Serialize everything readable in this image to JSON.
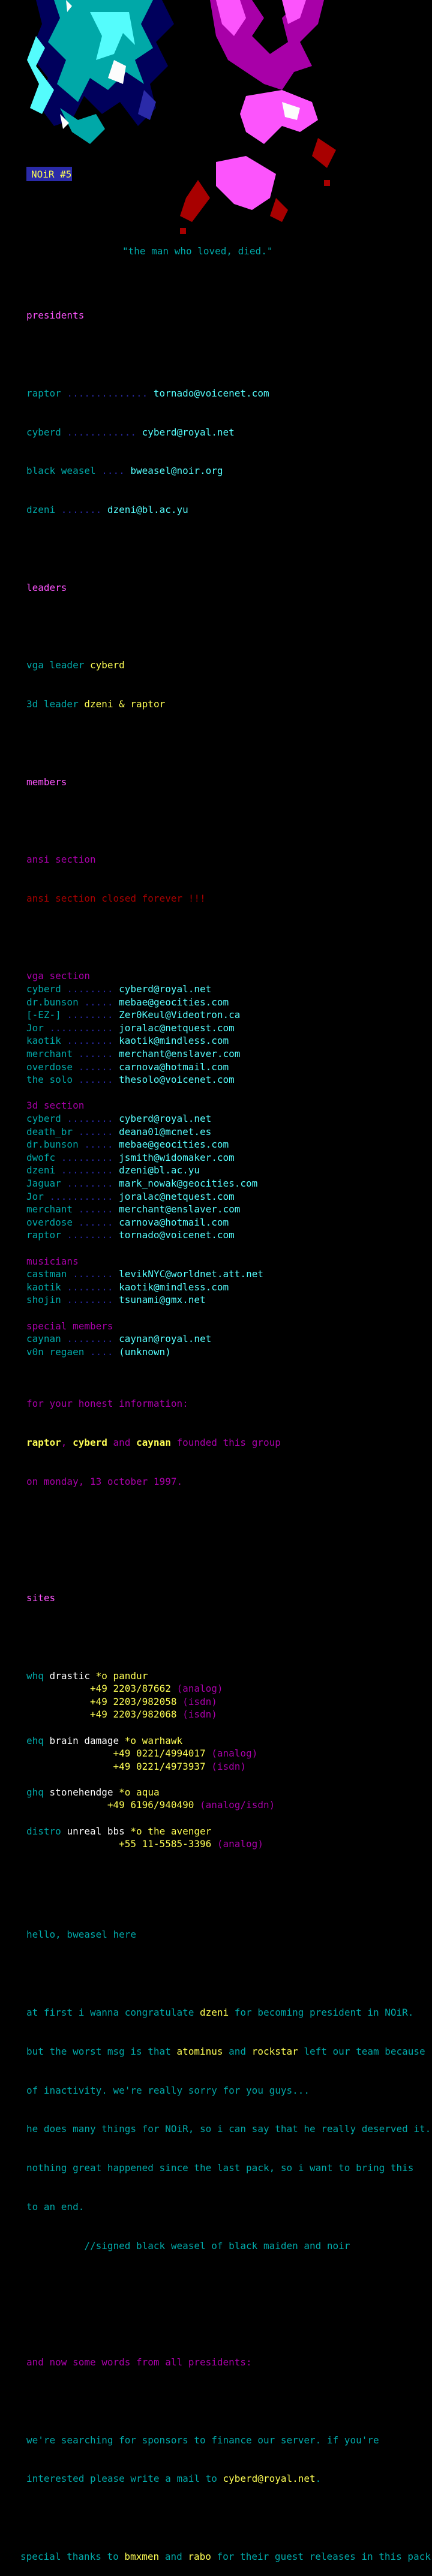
{
  "art": {
    "tag": "NOiR #5"
  },
  "tagline": "\"the man who loved, died.\"",
  "presidents": {
    "heading": "presidents",
    "rows": [
      {
        "name": "raptor",
        "email": "tornado@voicenet.com"
      },
      {
        "name": "cyberd",
        "email": "cyberd@royal.net"
      },
      {
        "name": "black weasel",
        "email": "bweasel@noir.org"
      },
      {
        "name": "dzeni",
        "email": "dzeni@bl.ac.yu"
      }
    ]
  },
  "leaders": {
    "heading": "leaders",
    "rows": [
      {
        "role": "vga leader",
        "who": "cyberd"
      },
      {
        "role": "3d leader",
        "who": "dzeni & raptor"
      }
    ]
  },
  "members": {
    "heading": "members",
    "ansi": {
      "heading": "ansi section",
      "note": "ansi section closed forever !!!"
    },
    "sections": [
      {
        "heading": "vga section",
        "rows": [
          {
            "name": "cyberd",
            "email": "cyberd@royal.net"
          },
          {
            "name": "dr.bunson",
            "email": "mebae@geocities.com"
          },
          {
            "name": "[-EZ-]",
            "email": "Zer0Keul@Videotron.ca"
          },
          {
            "name": "Jor",
            "email": "joralac@netquest.com"
          },
          {
            "name": "kaotik",
            "email": "kaotik@mindless.com"
          },
          {
            "name": "merchant",
            "email": "merchant@enslaver.com"
          },
          {
            "name": "overdose",
            "email": "carnova@hotmail.com"
          },
          {
            "name": "the solo",
            "email": "thesolo@voicenet.com"
          }
        ]
      },
      {
        "heading": "3d section",
        "rows": [
          {
            "name": "cyberd",
            "email": "cyberd@royal.net"
          },
          {
            "name": "death_br",
            "email": "deana01@mcnet.es"
          },
          {
            "name": "dr.bunson",
            "email": "mebae@geocities.com"
          },
          {
            "name": "dwofc",
            "email": "jsmith@widomaker.com"
          },
          {
            "name": "dzeni",
            "email": "dzeni@bl.ac.yu"
          },
          {
            "name": "Jaguar",
            "email": "mark_nowak@geocities.com"
          },
          {
            "name": "Jor",
            "email": "joralac@netquest.com"
          },
          {
            "name": "merchant",
            "email": "merchant@enslaver.com"
          },
          {
            "name": "overdose",
            "email": "carnova@hotmail.com"
          },
          {
            "name": "raptor",
            "email": "tornado@voicenet.com"
          }
        ]
      },
      {
        "heading": "musicians",
        "rows": [
          {
            "name": "castman",
            "email": "levikNYC@worldnet.att.net"
          },
          {
            "name": "kaotik",
            "email": "kaotik@mindless.com"
          },
          {
            "name": "shojin",
            "email": "tsunami@gmx.net"
          }
        ]
      },
      {
        "heading": "special members",
        "rows": [
          {
            "name": "caynan",
            "email": "caynan@royal.net"
          },
          {
            "name": "v0n regaen",
            "email": "(unknown)"
          }
        ]
      }
    ]
  },
  "info": {
    "heading": "for your honest information:",
    "founders": [
      "raptor",
      "cyberd",
      "caynan"
    ],
    "sep1": ", ",
    "and": " and ",
    "founded": " founded this group",
    "date": "on monday, 13 october 1997."
  },
  "sites": {
    "heading": "sites",
    "entries": [
      {
        "role": "whq",
        "board": "drastic",
        "sysop": "*o pandur",
        "pad": 9,
        "lines": [
          {
            "num": "+49 2203/87662",
            "tag": " (analog)"
          },
          {
            "num": "+49 2203/982058",
            "tag": " (isdn)"
          },
          {
            "num": "+49 2203/982068",
            "tag": " (isdn)"
          }
        ]
      },
      {
        "role": "ehq",
        "board": "brain damage",
        "sysop": "*o warhawk",
        "pad": 13,
        "lines": [
          {
            "num": "+49 0221/4994017",
            "tag": " (analog)"
          },
          {
            "num": "+49 0221/4973937",
            "tag": " (isdn)"
          }
        ]
      },
      {
        "role": "ghq",
        "board": "stonehendge",
        "sysop": "*o aqua",
        "pad": 12,
        "lines": [
          {
            "num": "+49 6196/940490",
            "tag": " (analog/isdn)"
          }
        ]
      },
      {
        "role": "distro",
        "board": "unreal bbs",
        "sysop": "*o the avenger",
        "pad": 14,
        "lines": [
          {
            "num": "+55 11-5585-3396",
            "tag": " (analog)"
          }
        ]
      }
    ]
  },
  "message": {
    "greeting": "hello, bweasel here",
    "p1a": "at first i wanna congratulate ",
    "p1name": "dzeni",
    "p1b": " for becoming president in NOiR.",
    "p2a": "but the worst msg is that ",
    "p2n1": "atominus",
    "p2and": " and ",
    "p2n2": "rockstar",
    "p2b": " left our team because",
    "p3": "of inactivity. we're really sorry for you guys...",
    "p4": "he does many things for NOiR, so i can say that he really deserved it.",
    "p5": "nothing great happened since the last pack, so i want to bring this",
    "p6": "to an end.",
    "signed": "          //signed black weasel of black maiden and noir"
  },
  "presidents_words": {
    "heading": "and now some words from all presidents:",
    "l1": "we're searching for sponsors to finance our server. if you're",
    "l2a": "interested please write a mail to ",
    "l2mail": "cyberd@royal.net",
    "l2b": "."
  },
  "thanks": {
    "a": "special thanks to ",
    "n1": "bmxmen",
    "and": " and ",
    "n2": "rabo",
    "b": " for their guest releases in this pack"
  },
  "colors": {
    "cyan": "#00a8a8",
    "bright_cyan": "#54fcfc",
    "yellow": "#fcfc54",
    "white": "#fcfcfc",
    "magenta": "#a800a8",
    "pink": "#fc54fc",
    "red": "#a80000",
    "blue": "#2a2aa8",
    "background": "#000000"
  }
}
